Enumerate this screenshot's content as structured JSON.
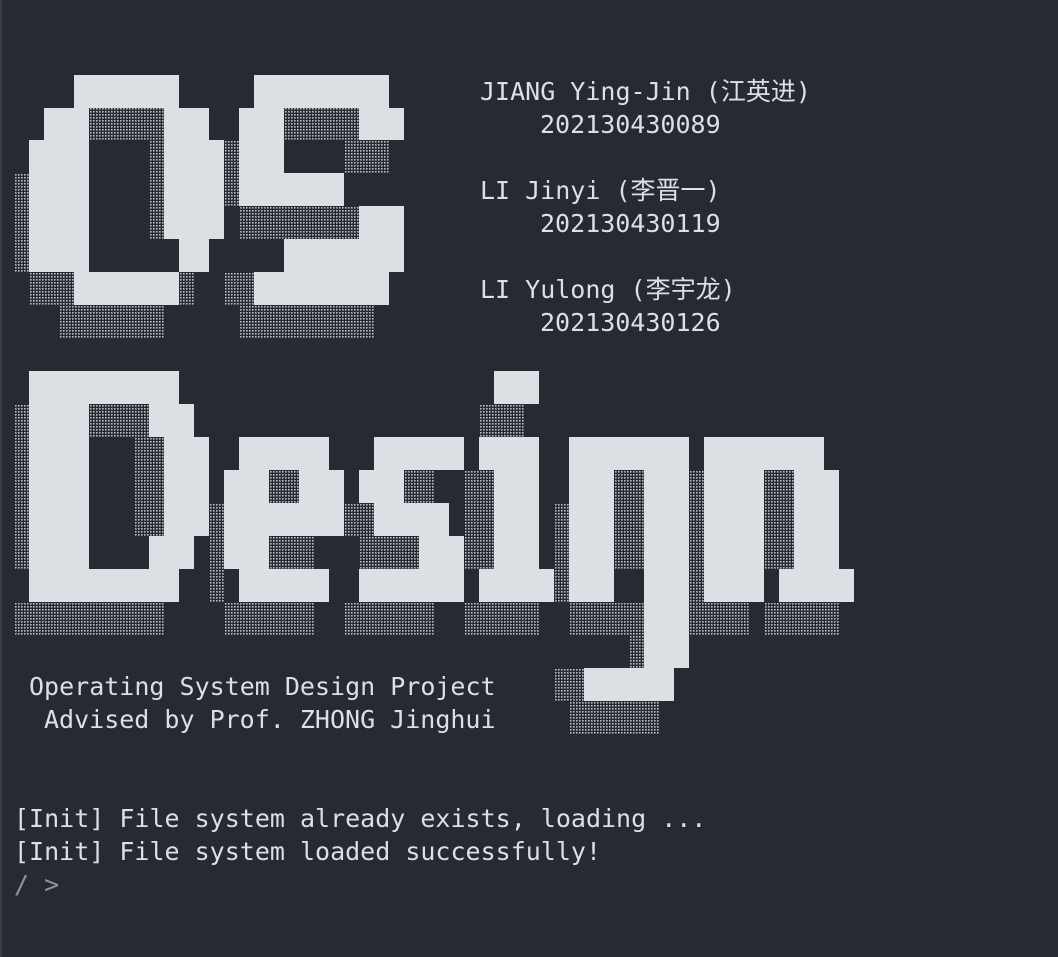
{
  "banner": {
    "title_line_1": "OS",
    "title_line_2": "Design"
  },
  "credits": [
    {
      "name": "JIANG Ying-Jin (江英进)",
      "id": "202130430089"
    },
    {
      "name": "LI Jinyi (李晋一)",
      "id": "202130430119"
    },
    {
      "name": "LI Yulong (李宇龙)",
      "id": "202130430126"
    }
  ],
  "project": {
    "line_1": "Operating System Design Project",
    "line_2": "Advised by Prof. ZHONG Jinghui"
  },
  "log": [
    "[Init] File system already exists, loading ...",
    "[Init] File system loaded successfully!"
  ],
  "prompt": "/ >",
  "colors": {
    "background": "#272a33",
    "foreground": "#dcdfe4",
    "prompt": "#8c95a6"
  }
}
